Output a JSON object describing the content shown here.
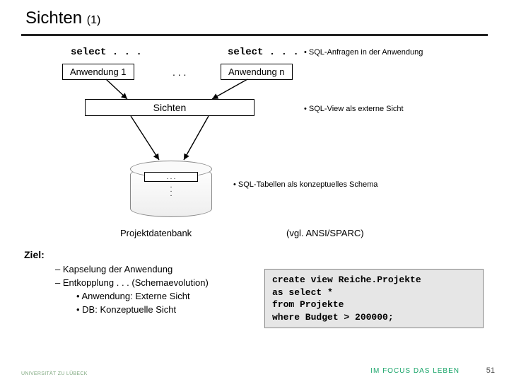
{
  "title": {
    "main": "Sichten",
    "sub": "(1)"
  },
  "select_label": "select . . .",
  "apps": {
    "a1": "Anwendung 1",
    "mid": ". . .",
    "an": "Anwendung n"
  },
  "notes": {
    "sql_anfragen": "• SQL-Anfragen in der Anwendung",
    "sql_view": "• SQL-View als externe Sicht",
    "sql_tabellen": "• SQL-Tabellen als konzeptuelles Schema"
  },
  "sichten_label": "Sichten",
  "db": {
    "inner": ". . .",
    "vdots": ".\n.\n.",
    "label": "Projektdatenbank"
  },
  "ansi": "(vgl. ANSI/SPARC)",
  "ziel": {
    "label": "Ziel:",
    "l1": "–   Kapselung der Anwendung",
    "l2": "–   Entkopplung . . . (Schemaevolution)",
    "l3": "•  Anwendung: Externe Sicht",
    "l4": "•  DB: Konzeptuelle Sicht"
  },
  "code": {
    "l1": "create view Reiche.Projekte",
    "l2": "as select *",
    "l3": "from Projekte",
    "l4": "where Budget > 200000;"
  },
  "page": "51",
  "footer": {
    "left": "UNIVERSITÄT ZU LÜBECK",
    "right": "IM FOCUS DAS LEBEN"
  }
}
